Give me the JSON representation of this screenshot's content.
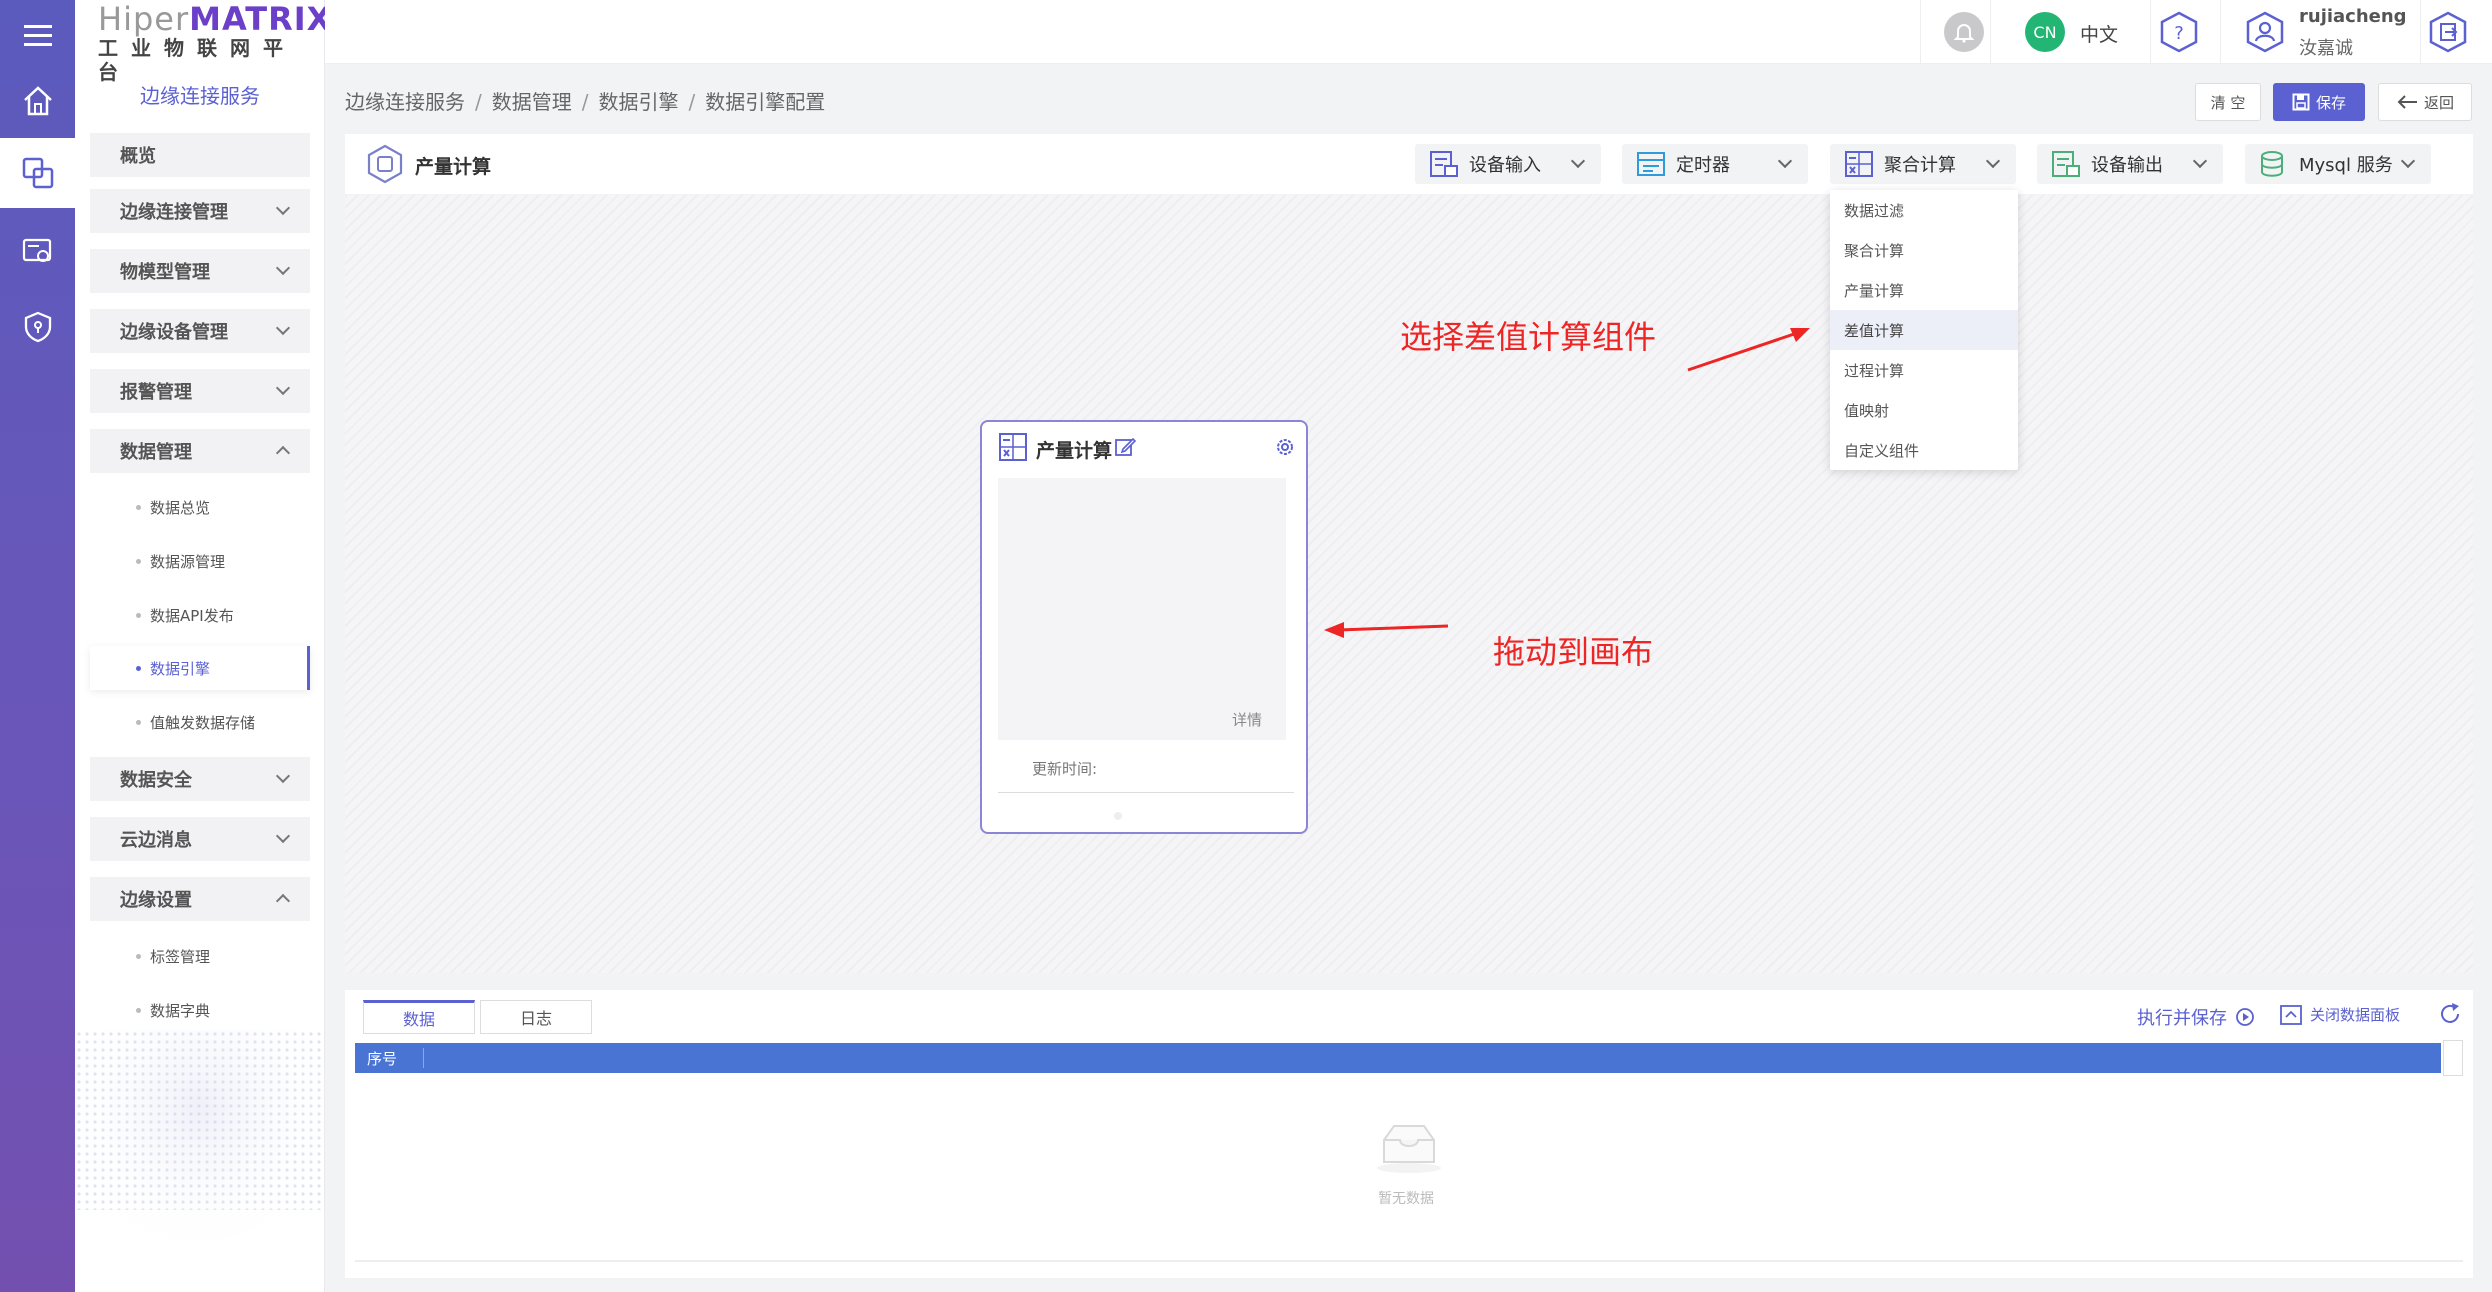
{
  "brand": {
    "logo_gray": "Hiper",
    "logo_purple": "MATRIX",
    "subtitle": "工业物联网平台"
  },
  "sidebar": {
    "title": "边缘连接服务",
    "menus": [
      {
        "label": "概览"
      },
      {
        "label": "边缘连接管理"
      },
      {
        "label": "物模型管理"
      },
      {
        "label": "边缘设备管理"
      },
      {
        "label": "报警管理"
      },
      {
        "label": "数据管理"
      },
      {
        "label": "数据安全"
      },
      {
        "label": "云边消息"
      },
      {
        "label": "边缘设置"
      }
    ],
    "data_sub": [
      "数据总览",
      "数据源管理",
      "数据API发布",
      "数据引擎",
      "值触发数据存储"
    ],
    "settings_sub": [
      "标签管理",
      "数据字典"
    ]
  },
  "topbar": {
    "avatar_badge": "CN",
    "language": "中文",
    "username": "rujiacheng",
    "display_name": "汝嘉诚"
  },
  "breadcrumb": [
    "边缘连接服务",
    "数据管理",
    "数据引擎",
    "数据引擎配置"
  ],
  "actions": {
    "clear": "清 空",
    "save": "保存",
    "back": "返回"
  },
  "toolbar": {
    "title": "产量计算",
    "tools": [
      "设备输入",
      "定时器",
      "聚合计算",
      "设备输出",
      "Mysql 服务"
    ]
  },
  "dropdown": {
    "items": [
      "数据过滤",
      "聚合计算",
      "产量计算",
      "差值计算",
      "过程计算",
      "值映射",
      "自定义组件"
    ],
    "highlighted": "差值计算"
  },
  "node": {
    "title": "产量计算",
    "detail": "详情",
    "update_label": "更新时间:"
  },
  "annotations": {
    "select": "选择差值计算组件",
    "drag": "拖动到画布"
  },
  "panel": {
    "tabs": [
      "数据",
      "日志"
    ],
    "run_save": "执行并保存",
    "close_panel": "关闭数据面板",
    "column": "序号",
    "empty": "暂无数据"
  },
  "colors": {
    "accent": "#5b61d1",
    "rail": "#5b5bbd",
    "header": "#4a74d4",
    "annotation": "#ee2525"
  }
}
